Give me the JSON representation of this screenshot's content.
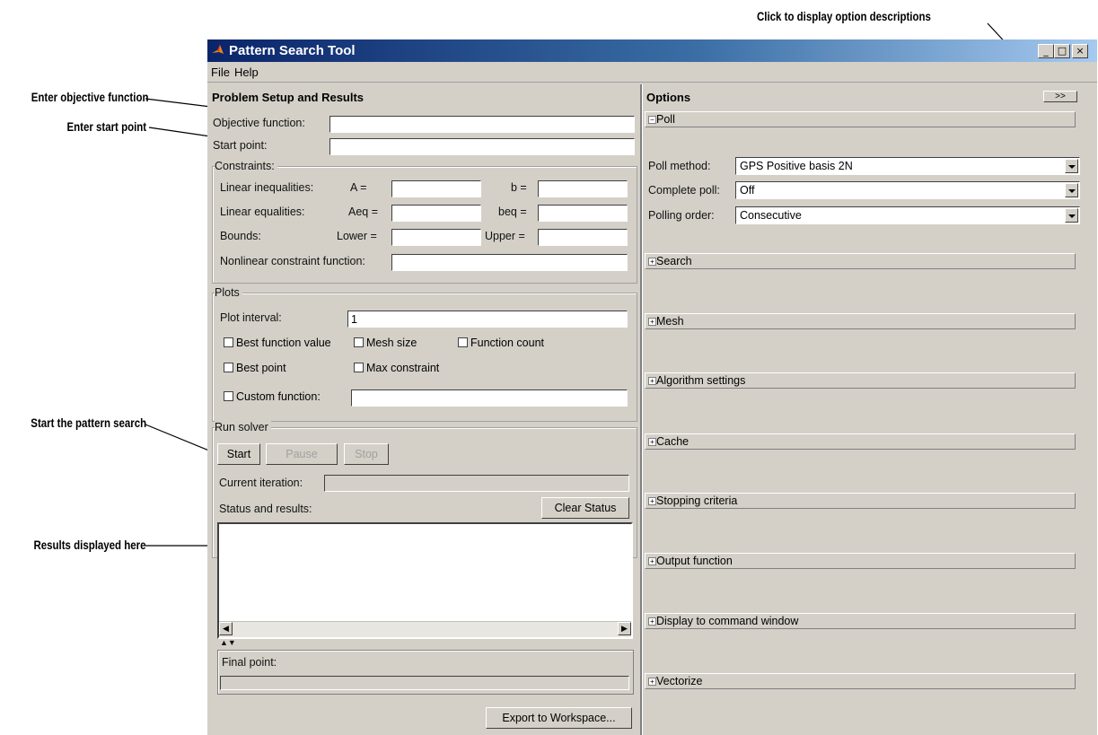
{
  "annotations": {
    "objective": "Enter objective function",
    "start_point": "Enter start point",
    "start_search": "Start the pattern search",
    "results": "Results displayed here",
    "descriptions": "Click to display option descriptions"
  },
  "window": {
    "title": "Pattern Search Tool",
    "controls": {
      "minimize": "_",
      "maximize": "□",
      "close": "×"
    }
  },
  "menu": {
    "file": "File",
    "help": "Help"
  },
  "problem": {
    "header": "Problem Setup and Results",
    "objective_label": "Objective function:",
    "objective_value": "",
    "start_label": "Start point:",
    "start_value": "",
    "constraints_label": "Constraints:",
    "lin_ineq_label": "Linear inequalities:",
    "A_label": "A =",
    "b_label": "b =",
    "lin_eq_label": "Linear equalities:",
    "Aeq_label": "Aeq =",
    "beq_label": "beq =",
    "bounds_label": "Bounds:",
    "lower_label": "Lower =",
    "upper_label": "Upper =",
    "nonlin_label": "Nonlinear constraint function:"
  },
  "plots": {
    "header": "Plots",
    "interval_label": "Plot interval:",
    "interval_value": "1",
    "best_function_value": "Best function value",
    "mesh_size": "Mesh size",
    "function_count": "Function count",
    "best_point": "Best point",
    "max_constraint": "Max constraint",
    "custom_function": "Custom function:"
  },
  "run": {
    "header": "Run solver",
    "start": "Start",
    "pause": "Pause",
    "stop": "Stop",
    "iteration_label": "Current iteration:",
    "status_label": "Status and results:",
    "clear_status": "Clear Status",
    "final_point_label": "Final point:",
    "export": "Export to Workspace..."
  },
  "options": {
    "header": "Options",
    "toggle": ">>",
    "poll_section": "Poll",
    "poll_method_label": "Poll method:",
    "poll_method_value": "GPS Positive basis 2N",
    "complete_poll_label": "Complete poll:",
    "complete_poll_value": "Off",
    "polling_order_label": "Polling order:",
    "polling_order_value": "Consecutive",
    "sections": [
      "Search",
      "Mesh",
      "Algorithm settings",
      "Cache",
      "Stopping criteria",
      "Output function",
      "Display to command window",
      "Vectorize"
    ]
  }
}
